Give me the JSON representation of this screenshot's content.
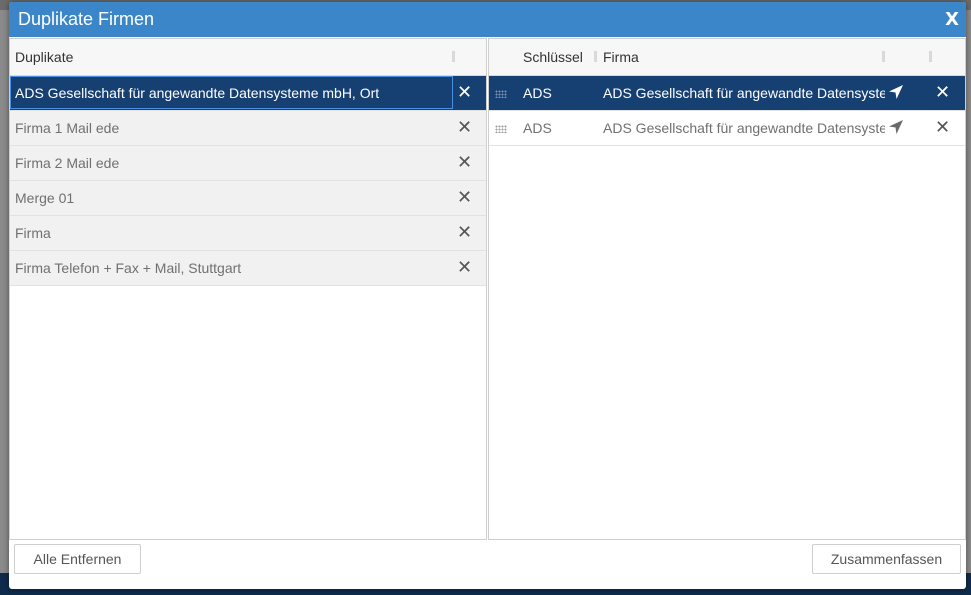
{
  "dialog": {
    "title": "Duplikate Firmen",
    "close_label": "X"
  },
  "left_grid": {
    "header": "Duplikate",
    "rows": [
      {
        "name": "ADS Gesellschaft für angewandte Datensysteme mbH, Ort",
        "selected": true
      },
      {
        "name": "Firma 1 Mail ede",
        "selected": false
      },
      {
        "name": "Firma 2 Mail ede",
        "selected": false
      },
      {
        "name": "Merge 01",
        "selected": false
      },
      {
        "name": "Firma",
        "selected": false
      },
      {
        "name": "Firma Telefon + Fax + Mail, Stuttgart",
        "selected": false
      }
    ]
  },
  "right_grid": {
    "headers": {
      "key": "Schlüssel",
      "company": "Firma"
    },
    "rows": [
      {
        "key": "ADS",
        "company": "ADS Gesellschaft für angewandte Datensyste",
        "selected": true
      },
      {
        "key": "ADS",
        "company": "ADS Gesellschaft für angewandte Datensyste",
        "selected": false
      }
    ]
  },
  "footer": {
    "remove_all_label": "Alle Entfernen",
    "merge_label": "Zusammenfassen"
  },
  "colors": {
    "header_blue": "#3a86c8",
    "selected_row": "#163f72"
  },
  "icons": {
    "remove": "close-icon",
    "navigate": "location-arrow-icon",
    "drag": "drag-handle-icon"
  }
}
